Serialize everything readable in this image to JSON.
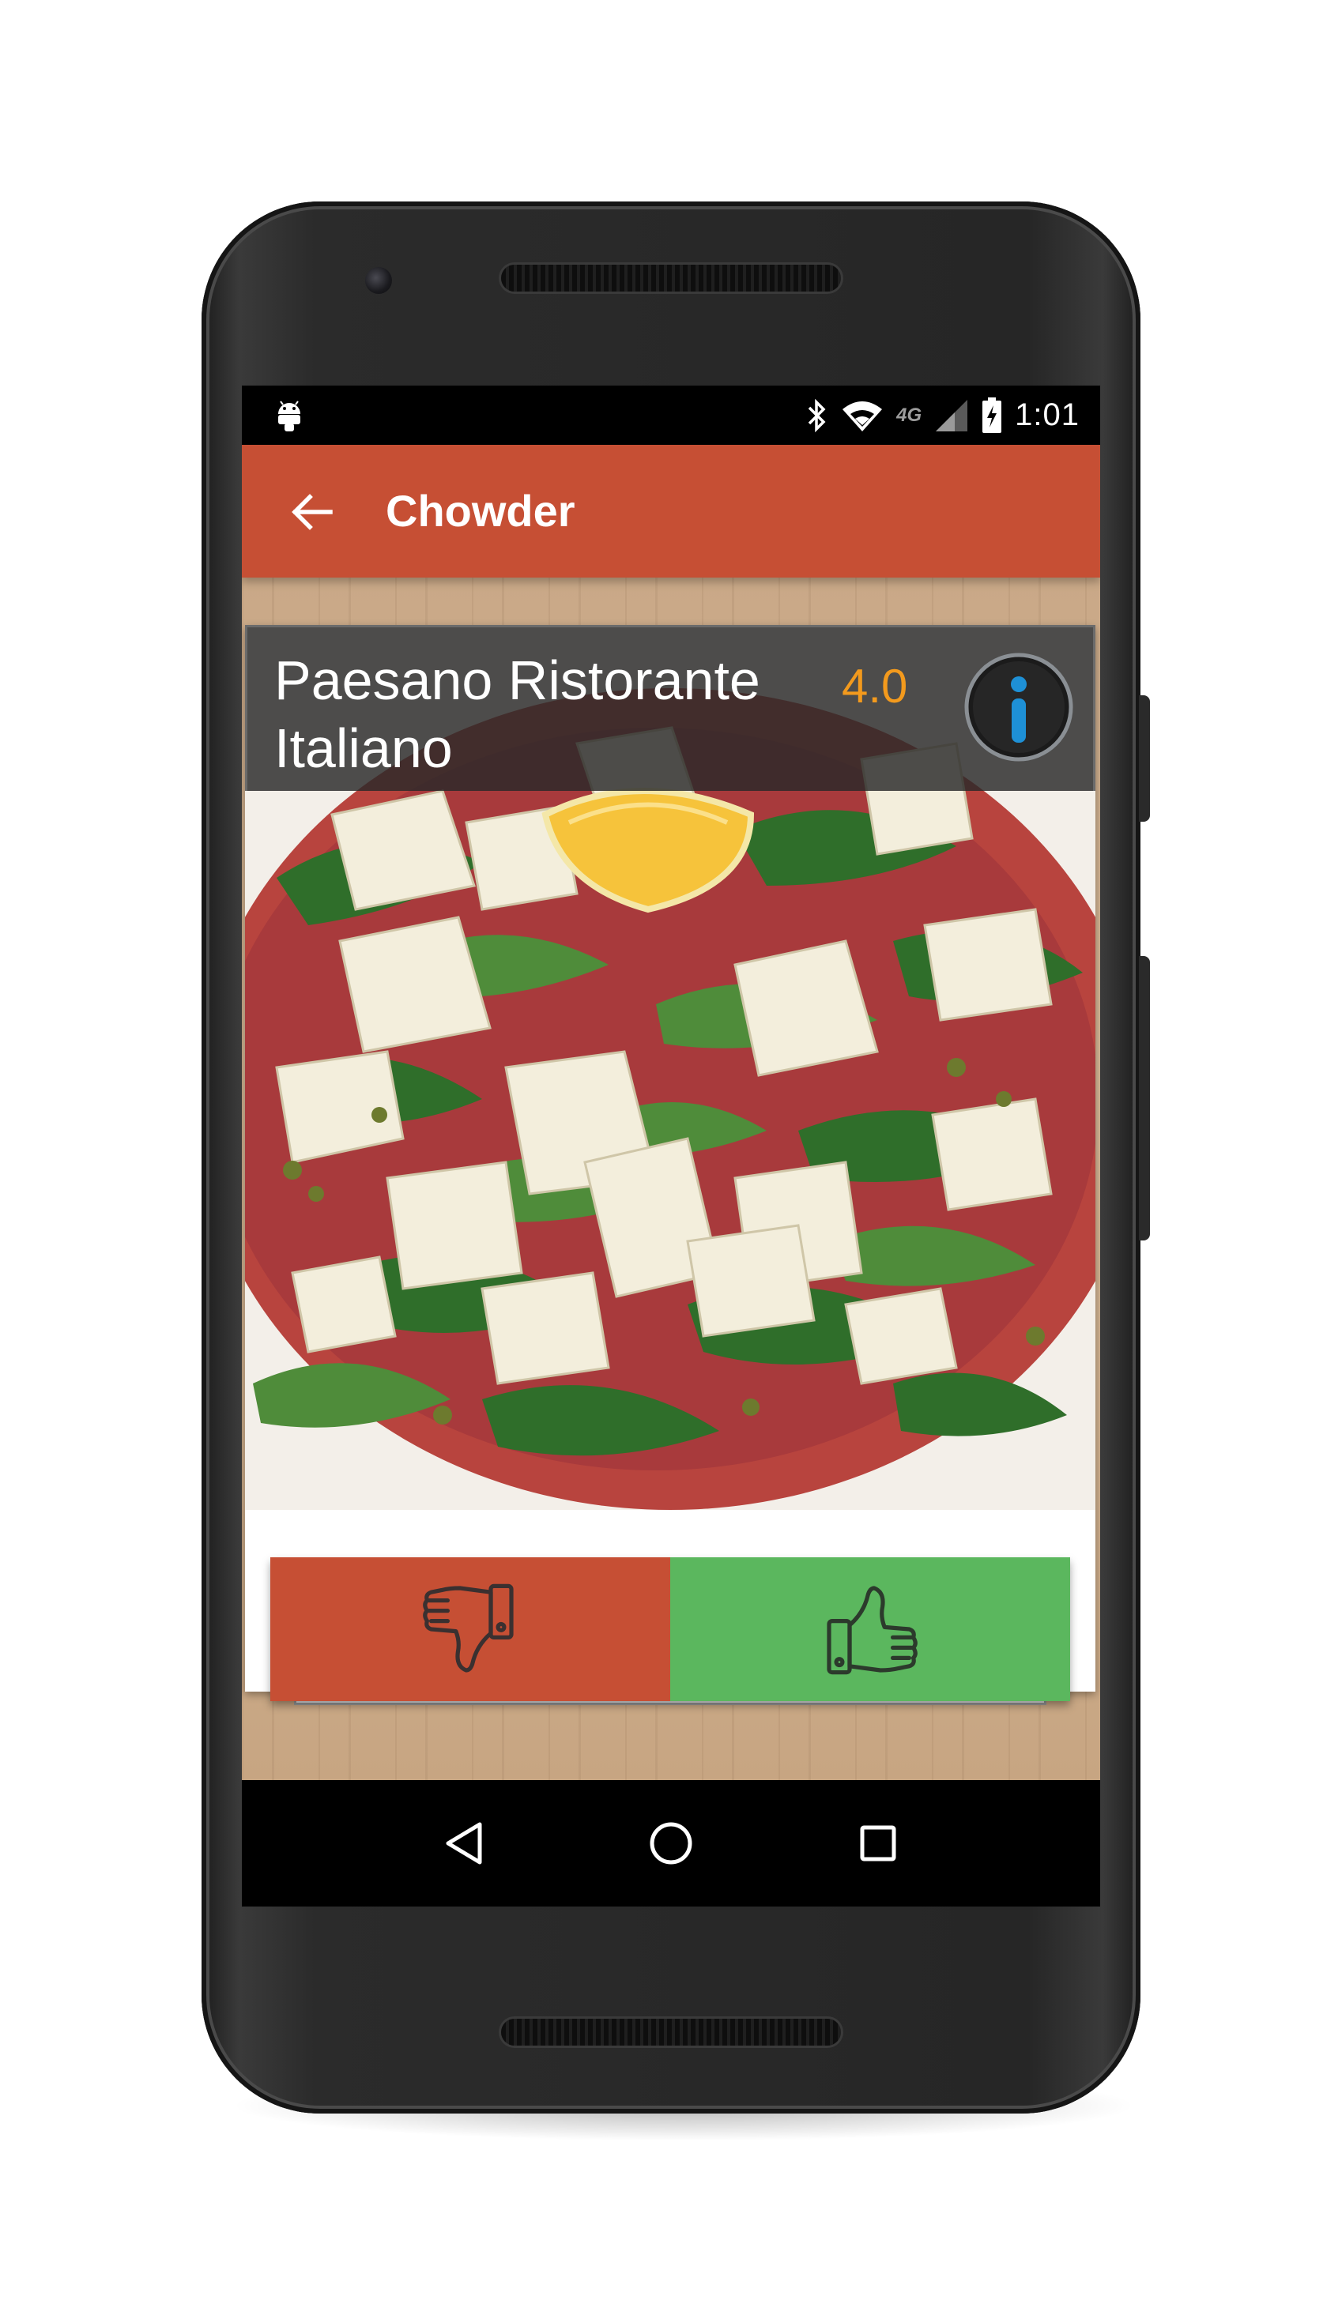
{
  "status_bar": {
    "time": "1:01",
    "network": "4G",
    "icons": [
      "android-icon",
      "bluetooth-icon",
      "wifi-icon",
      "cell-signal-icon",
      "battery-charging-icon"
    ]
  },
  "toolbar": {
    "title": "Chowder",
    "back_icon": "arrow-back-icon"
  },
  "card": {
    "restaurant_name": "Paesano Ristorante Italiano",
    "rating": "4.0",
    "info_icon": "info-icon",
    "photo": "arugula-parmesan-carpaccio-salad-photo"
  },
  "actions": {
    "dislike_icon": "thumbs-down-icon",
    "like_icon": "thumbs-up-icon"
  },
  "nav_bar": {
    "icons": [
      "back-triangle-icon",
      "home-circle-icon",
      "recents-square-icon"
    ]
  },
  "colors": {
    "toolbar": "#c64f34",
    "dislike": "#c64f34",
    "like": "#5bb75e",
    "rating": "#f39a1d",
    "info_accent": "#1e90d6"
  }
}
